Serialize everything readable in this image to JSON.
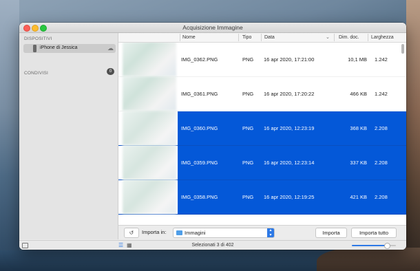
{
  "window": {
    "title": "Acquisizione Immagine"
  },
  "sidebar": {
    "devices_heading": "DISPOSITIVI",
    "device": {
      "label": "iPhone di Jessica",
      "icon": "iphone-icon",
      "status_icon": "cloud-icon"
    },
    "shared_heading": "CONDIVISI",
    "shared_count": "0"
  },
  "table": {
    "columns": [
      "Nome",
      "Tipo",
      "Data",
      "Dim. doc.",
      "Larghezza"
    ],
    "sort_column": "Data",
    "rows": [
      {
        "name": "IMG_0362.PNG",
        "type": "PNG",
        "date": "16 apr 2020, 17:21:00",
        "size": "10,1 MB",
        "width": "1.242",
        "selected": false
      },
      {
        "name": "IMG_0361.PNG",
        "type": "PNG",
        "date": "16 apr 2020, 17:20:22",
        "size": "466 KB",
        "width": "1.242",
        "selected": false
      },
      {
        "name": "IMG_0360.PNG",
        "type": "PNG",
        "date": "16 apr 2020, 12:23:19",
        "size": "368 KB",
        "width": "2.208",
        "selected": true
      },
      {
        "name": "IMG_0359.PNG",
        "type": "PNG",
        "date": "16 apr 2020, 12:23:14",
        "size": "337 KB",
        "width": "2.208",
        "selected": true
      },
      {
        "name": "IMG_0358.PNG",
        "type": "PNG",
        "date": "16 apr 2020, 12:19:25",
        "size": "421 KB",
        "width": "2.208",
        "selected": true
      }
    ]
  },
  "bottombar": {
    "rotate_icon": "rotate-left-icon",
    "import_in_label": "Importa in:",
    "destination": "Immagini",
    "import_button": "Importa",
    "import_all_button": "Importa tutto"
  },
  "statusbar": {
    "selection_text": "Selezionati 3 di 402",
    "zoom_level": 0.8
  },
  "colors": {
    "selection": "#0458d8",
    "accent": "#2d79e6",
    "close": "#fc5f57",
    "minimize": "#fdbc2e",
    "maximize": "#28c840"
  }
}
